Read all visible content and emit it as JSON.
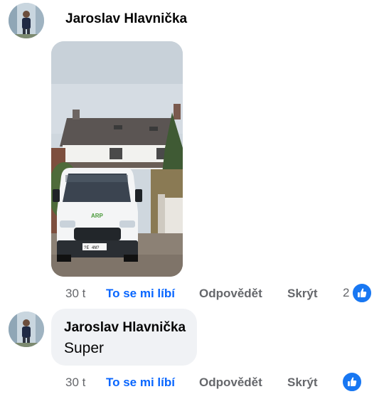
{
  "comments": [
    {
      "author": "Jaroslav Hlavnička",
      "text": "",
      "has_photo": true,
      "photo_desc_icon": "photo-white-van-house",
      "time": "30 t",
      "like_label": "To se mi líbí",
      "reply_label": "Odpovědět",
      "hide_label": "Skrýt",
      "reaction_count": "2",
      "reaction_icon": "thumbs-up-icon"
    },
    {
      "author": "Jaroslav Hlavnička",
      "text": "Super",
      "time": "30 t",
      "like_label": "To se mi líbí",
      "reply_label": "Odpovědět",
      "hide_label": "Skrýt",
      "reaction_count": "",
      "reaction_icon": "thumbs-up-icon"
    }
  ],
  "colors": {
    "like_accent": "#0866ff",
    "muted_text": "#65676b",
    "bubble_bg": "#f0f2f5",
    "reaction_blue": "#1877f2"
  }
}
